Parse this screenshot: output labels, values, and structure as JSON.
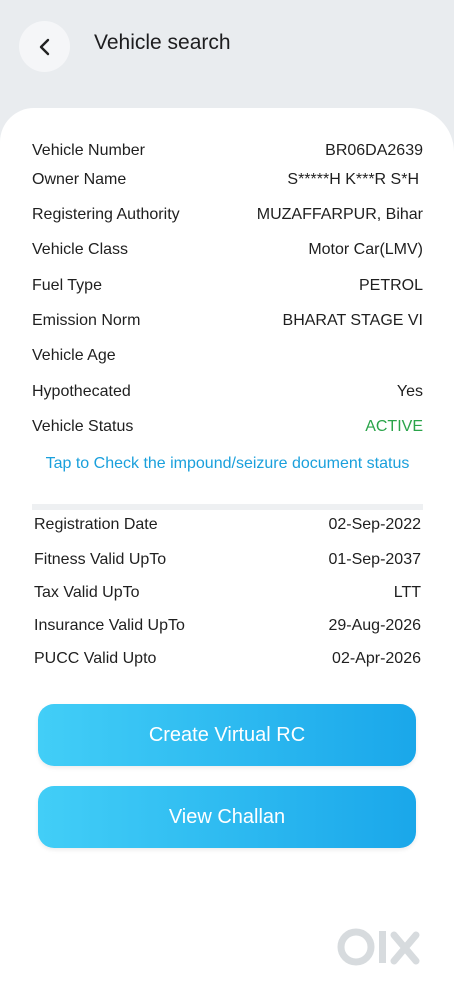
{
  "header": {
    "title": "Vehicle search",
    "back_icon": "chevron-left-icon"
  },
  "details": [
    {
      "label": "Vehicle Number",
      "value": "BR06DA2639"
    },
    {
      "label": "Owner Name",
      "value": "S*****H K***R S*H"
    },
    {
      "label": "Registering Authority",
      "value": "MUZAFFARPUR, Bihar"
    },
    {
      "label": "Vehicle Class",
      "value": "Motor Car(LMV)"
    },
    {
      "label": "Fuel Type",
      "value": "PETROL"
    },
    {
      "label": "Emission Norm",
      "value": "BHARAT STAGE VI"
    },
    {
      "label": "Vehicle Age",
      "value": ""
    },
    {
      "label": "Hypothecated",
      "value": "Yes"
    },
    {
      "label": "Vehicle Status",
      "value": "ACTIVE"
    }
  ],
  "impound_link": "Tap to Check the impound/seizure document status",
  "validity": [
    {
      "label": "Registration Date",
      "value": "02-Sep-2022"
    },
    {
      "label": "Fitness Valid UpTo",
      "value": "01-Sep-2037"
    },
    {
      "label": "Tax Valid UpTo",
      "value": "LTT"
    },
    {
      "label": "Insurance Valid UpTo",
      "value": "29-Aug-2026"
    },
    {
      "label": "PUCC Valid Upto",
      "value": "02-Apr-2026"
    }
  ],
  "buttons": {
    "create_virtual_rc": "Create Virtual RC",
    "view_challan": "View Challan"
  },
  "watermark": {
    "text": "OLX",
    "icon": "olx-logo-icon"
  },
  "colors": {
    "accent": "#1aa7ea",
    "status_active": "#2aa44a",
    "link": "#1aa0dc"
  }
}
